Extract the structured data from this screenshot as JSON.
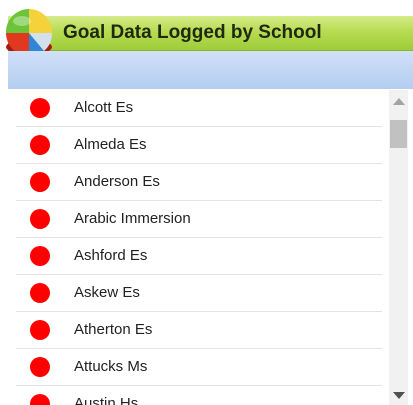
{
  "header": {
    "title": "Goal Data Logged by School",
    "icon": "pie-chart-icon"
  },
  "colors": {
    "header_green": "#b7db52",
    "subheader_blue": "#b4cdf1",
    "status_red": "#ff0000"
  },
  "schools": [
    {
      "label": "Alcott Es",
      "status": "red"
    },
    {
      "label": "Almeda Es",
      "status": "red"
    },
    {
      "label": "Anderson Es",
      "status": "red"
    },
    {
      "label": "Arabic Immersion",
      "status": "red"
    },
    {
      "label": "Ashford Es",
      "status": "red"
    },
    {
      "label": "Askew Es",
      "status": "red"
    },
    {
      "label": "Atherton Es",
      "status": "red"
    },
    {
      "label": "Attucks Ms",
      "status": "red"
    },
    {
      "label": "Austin Hs",
      "status": "red"
    }
  ]
}
